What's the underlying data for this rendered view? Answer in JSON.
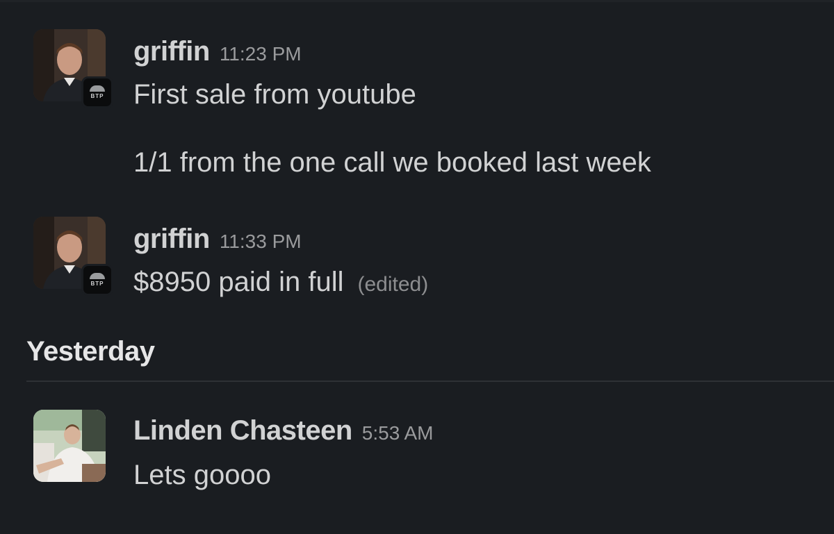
{
  "messages": [
    {
      "author": "griffin",
      "time": "11:23 PM",
      "lines": [
        "First sale from youtube",
        "1/1 from the one call we booked last week"
      ],
      "badge_text": "BTP"
    },
    {
      "author": "griffin",
      "time": "11:33 PM",
      "lines": [
        "$8950 paid in full"
      ],
      "edited_label": "(edited)",
      "badge_text": "BTP"
    },
    {
      "author": "Linden Chasteen",
      "time": "5:53 AM",
      "lines": [
        "Lets goooo"
      ]
    }
  ],
  "day_divider": {
    "label": "Yesterday"
  },
  "colors": {
    "background": "#1a1d21",
    "text": "#d1d2d3",
    "muted": "#9a9b9d",
    "divider": "#2e3135"
  }
}
